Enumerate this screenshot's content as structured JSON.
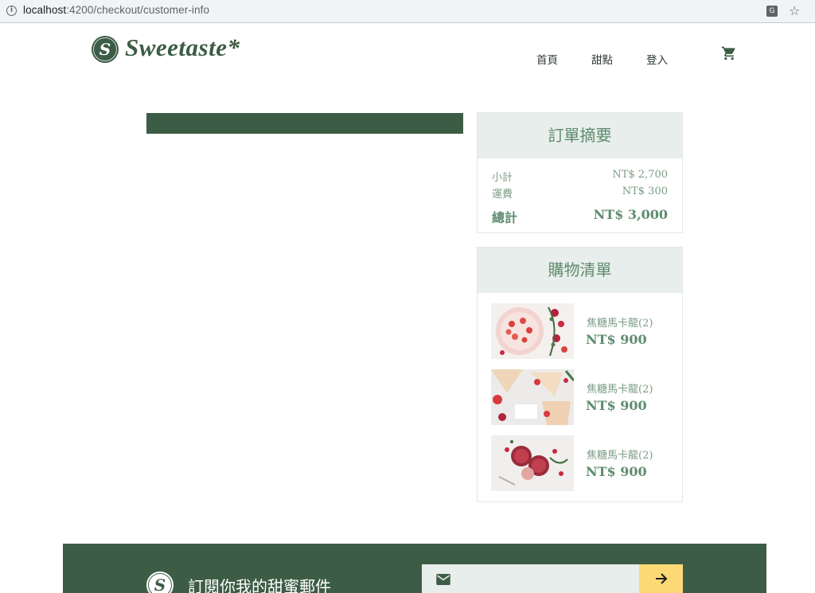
{
  "browser": {
    "url_host": "localhost",
    "url_path": ":4200/checkout/customer-info",
    "info_icon": "info-icon",
    "translate_icon": "translate-icon",
    "bookmark_icon": "star-icon"
  },
  "header": {
    "logo_mark": "S",
    "logo_text": "Sweetaste*",
    "nav": [
      "首頁",
      "甜點",
      "登入"
    ],
    "cart_icon": "shopping-cart-icon"
  },
  "order_summary": {
    "title": "訂單摘要",
    "subtotal_label": "小計",
    "subtotal_value": "NT$ 2,700",
    "shipping_label": "運費",
    "shipping_value": "NT$ 300",
    "total_label": "總計",
    "total_value": "NT$ 3,000"
  },
  "cart_list": {
    "title": "購物清單",
    "items": [
      {
        "name": "焦糖馬卡龍(2)",
        "price": "NT$ 900"
      },
      {
        "name": "焦糖馬卡龍(2)",
        "price": "NT$ 900"
      },
      {
        "name": "焦糖馬卡龍(2)",
        "price": "NT$ 900"
      }
    ]
  },
  "footer": {
    "logo_mark": "S",
    "subscribe_text": "訂閱你我的甜蜜郵件",
    "email_placeholder": "",
    "mail_icon": "mail-icon",
    "submit_icon": "arrow-right-icon"
  },
  "colors": {
    "brand_green": "#3d5c45",
    "light_green_bg": "#e8eeeb",
    "text_green": "#5e8c6d",
    "accent_yellow": "#fcd975"
  }
}
